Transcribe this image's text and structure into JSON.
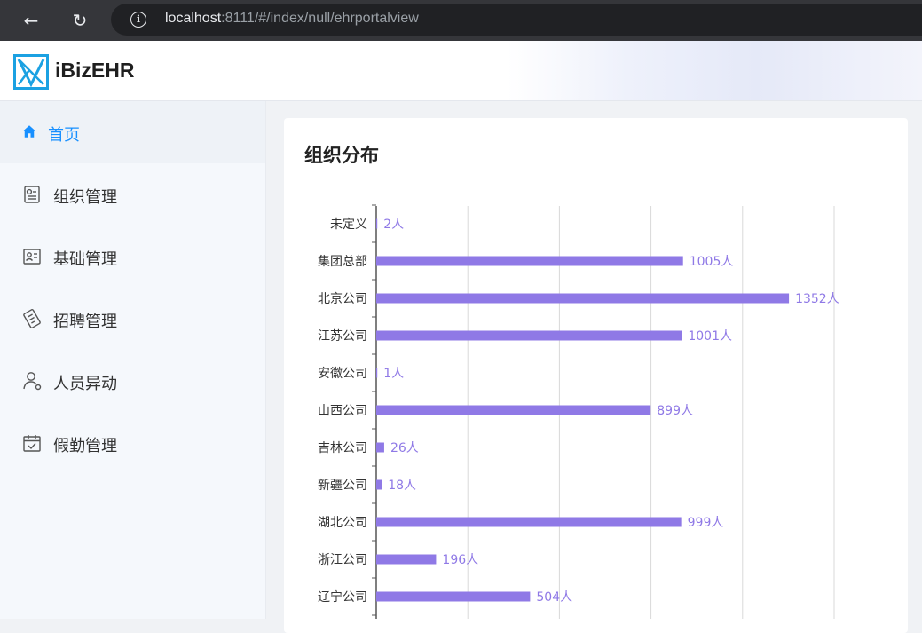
{
  "browser": {
    "url_host": "localhost",
    "url_rest": ":8111/#/index/null/ehrportalview"
  },
  "app": {
    "title": "iBizEHR"
  },
  "sidebar": {
    "items": [
      {
        "label": "首页",
        "icon": "home-icon",
        "active": true
      },
      {
        "label": "组织管理",
        "icon": "org-settings-icon",
        "active": false
      },
      {
        "label": "基础管理",
        "icon": "id-card-icon",
        "active": false
      },
      {
        "label": "招聘管理",
        "icon": "document-icon",
        "active": false
      },
      {
        "label": "人员异动",
        "icon": "person-icon",
        "active": false
      },
      {
        "label": "假勤管理",
        "icon": "calendar-icon",
        "active": false
      }
    ]
  },
  "card": {
    "title": "组织分布"
  },
  "chart_data": {
    "type": "bar",
    "orientation": "horizontal",
    "categories": [
      "未定义",
      "集团总部",
      "北京公司",
      "江苏公司",
      "安徽公司",
      "山西公司",
      "吉林公司",
      "新疆公司",
      "湖北公司",
      "浙江公司",
      "辽宁公司"
    ],
    "values": [
      2,
      1005,
      1352,
      1001,
      1,
      899,
      26,
      18,
      999,
      196,
      504
    ],
    "unit": "人",
    "xlim": [
      0,
      1500
    ],
    "grid": true,
    "bar_color": "#8f79e6",
    "label_color": "#8f79e6"
  }
}
